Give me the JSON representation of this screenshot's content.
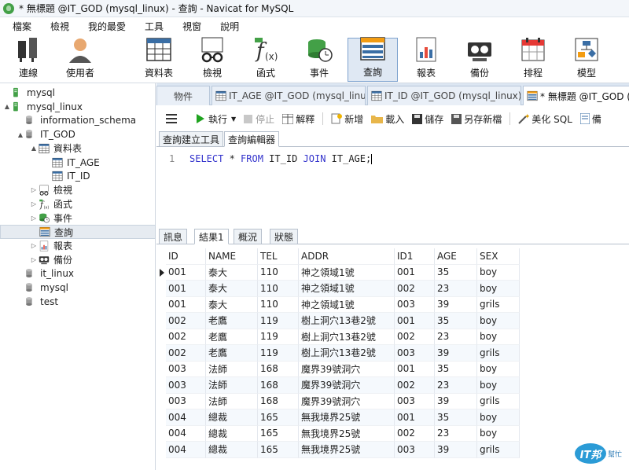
{
  "window": {
    "title": "* 無標題 @IT_GOD (mysql_linux) - 查詢 - Navicat for MySQL"
  },
  "menu": [
    "檔案",
    "檢視",
    "我的最愛",
    "工具",
    "視窗",
    "說明"
  ],
  "toolbar": [
    {
      "label": "連線",
      "icon": "connection-icon"
    },
    {
      "label": "使用者",
      "icon": "user-icon"
    },
    {
      "label": "資料表",
      "icon": "table-icon"
    },
    {
      "label": "檢視",
      "icon": "view-icon"
    },
    {
      "label": "函式",
      "icon": "function-icon"
    },
    {
      "label": "事件",
      "icon": "event-icon"
    },
    {
      "label": "查詢",
      "icon": "query-icon",
      "active": true
    },
    {
      "label": "報表",
      "icon": "report-icon"
    },
    {
      "label": "備份",
      "icon": "backup-icon"
    },
    {
      "label": "排程",
      "icon": "schedule-icon"
    },
    {
      "label": "模型",
      "icon": "model-icon"
    }
  ],
  "tree": [
    {
      "label": "mysql",
      "icon": "server-icon",
      "level": 0,
      "twisty": ""
    },
    {
      "label": "mysql_linux",
      "icon": "server-icon",
      "level": 0,
      "twisty": "▲"
    },
    {
      "label": "information_schema",
      "icon": "database-icon",
      "level": 1,
      "twisty": ""
    },
    {
      "label": "IT_GOD",
      "icon": "database-icon",
      "level": 1,
      "twisty": "▲"
    },
    {
      "label": "資料表",
      "icon": "table-icon",
      "level": 2,
      "twisty": "▲"
    },
    {
      "label": "IT_AGE",
      "icon": "table-icon",
      "level": 3,
      "twisty": ""
    },
    {
      "label": "IT_ID",
      "icon": "table-icon",
      "level": 3,
      "twisty": ""
    },
    {
      "label": "檢視",
      "icon": "view-icon",
      "level": 2,
      "twisty": "▷"
    },
    {
      "label": "函式",
      "icon": "function-icon",
      "level": 2,
      "twisty": "▷"
    },
    {
      "label": "事件",
      "icon": "event-icon",
      "level": 2,
      "twisty": "▷"
    },
    {
      "label": "查詢",
      "icon": "query-icon",
      "level": 2,
      "twisty": "",
      "selected": true
    },
    {
      "label": "報表",
      "icon": "report-icon",
      "level": 2,
      "twisty": "▷"
    },
    {
      "label": "備份",
      "icon": "backup-icon",
      "level": 2,
      "twisty": "▷"
    },
    {
      "label": "it_linux",
      "icon": "database-icon",
      "level": 1,
      "twisty": ""
    },
    {
      "label": "mysql",
      "icon": "database-icon",
      "level": 1,
      "twisty": ""
    },
    {
      "label": "test",
      "icon": "database-icon",
      "level": 1,
      "twisty": ""
    }
  ],
  "doc_tabs": [
    "物件",
    "IT_AGE @IT_GOD (mysql_linu...",
    "IT_ID @IT_GOD (mysql_linux)",
    "* 無標題 @IT_GOD (m"
  ],
  "query_toolbar": {
    "run": "執行",
    "stop": "停止",
    "explain": "解釋",
    "new": "新增",
    "load": "載入",
    "save": "儲存",
    "save_as": "另存新檔",
    "beautify": "美化 SQL",
    "note": "備"
  },
  "sub_tabs": [
    "查詢建立工具",
    "查詢編輯器"
  ],
  "editor": {
    "line_no": "1",
    "sql_kw1": "SELECT",
    "sql_p1": " * ",
    "sql_kw2": "FROM",
    "sql_p2": " IT_ID ",
    "sql_kw3": "JOIN",
    "sql_p3": " IT_AGE;"
  },
  "result_tabs": [
    "訊息",
    "結果1",
    "概況",
    "狀態"
  ],
  "result": {
    "columns": [
      "ID",
      "NAME",
      "TEL",
      "ADDR",
      "ID1",
      "AGE",
      "SEX"
    ],
    "rows": [
      [
        "001",
        "泰大",
        "110",
        "神之領域1號",
        "001",
        "35",
        "boy"
      ],
      [
        "001",
        "泰大",
        "110",
        "神之領域1號",
        "002",
        "23",
        "boy"
      ],
      [
        "001",
        "泰大",
        "110",
        "神之領域1號",
        "003",
        "39",
        "grils"
      ],
      [
        "002",
        "老鷹",
        "119",
        "樹上洞穴13巷2號",
        "001",
        "35",
        "boy"
      ],
      [
        "002",
        "老鷹",
        "119",
        "樹上洞穴13巷2號",
        "002",
        "23",
        "boy"
      ],
      [
        "002",
        "老鷹",
        "119",
        "樹上洞穴13巷2號",
        "003",
        "39",
        "grils"
      ],
      [
        "003",
        "法師",
        "168",
        "魔界39號洞穴",
        "001",
        "35",
        "boy"
      ],
      [
        "003",
        "法師",
        "168",
        "魔界39號洞穴",
        "002",
        "23",
        "boy"
      ],
      [
        "003",
        "法師",
        "168",
        "魔界39號洞穴",
        "003",
        "39",
        "grils"
      ],
      [
        "004",
        "總裁",
        "165",
        "無我境界25號",
        "001",
        "35",
        "boy"
      ],
      [
        "004",
        "總裁",
        "165",
        "無我境界25號",
        "002",
        "23",
        "boy"
      ],
      [
        "004",
        "總裁",
        "165",
        "無我境界25號",
        "003",
        "39",
        "grils"
      ]
    ]
  },
  "watermark": {
    "badge": "IT邦",
    "text": "幫忙"
  },
  "colors": {
    "accent": "#3a6ea5",
    "keyword": "#3333cc",
    "run": "#1fa31f",
    "stripe": "#f5f9fd"
  }
}
